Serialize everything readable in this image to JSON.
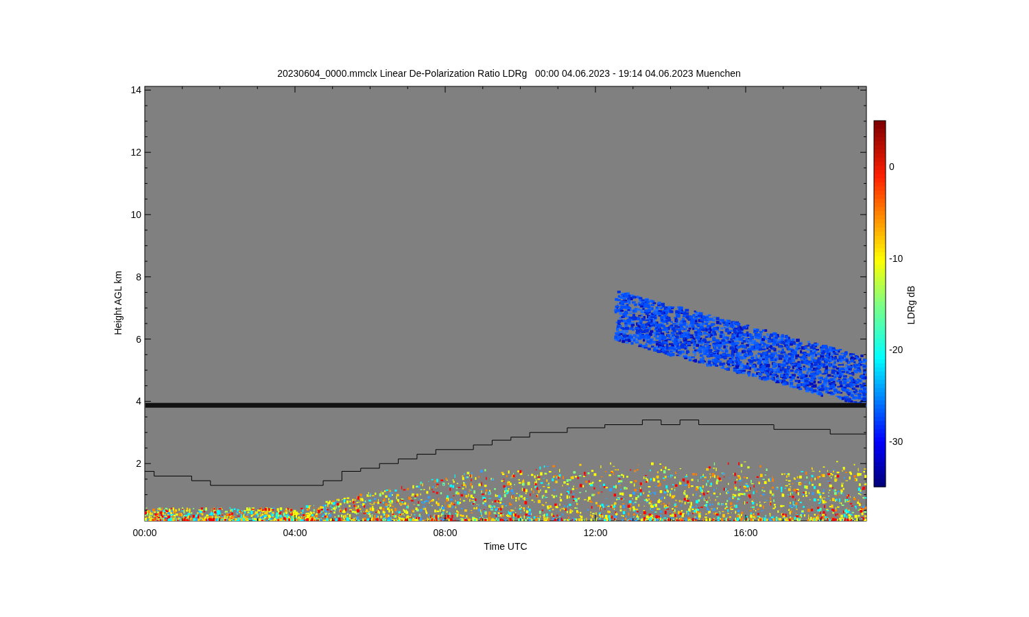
{
  "title": "20230604_0000.mmclx Linear De-Polarization Ratio LDRg   00:00 04.06.2023 - 19:14 04.06.2023 Muenchen",
  "y_axis": {
    "label": "Height AGL km",
    "ticks": [
      "14",
      "12",
      "10",
      "8",
      "6",
      "4",
      "2"
    ]
  },
  "x_axis": {
    "label": "Time UTC",
    "ticks": [
      "00:00",
      "04:00",
      "08:00",
      "12:00",
      "16:00"
    ]
  },
  "colorbar": {
    "label": "LDRg dB",
    "ticks": [
      "0",
      "-10",
      "-20",
      "-30"
    ]
  }
}
